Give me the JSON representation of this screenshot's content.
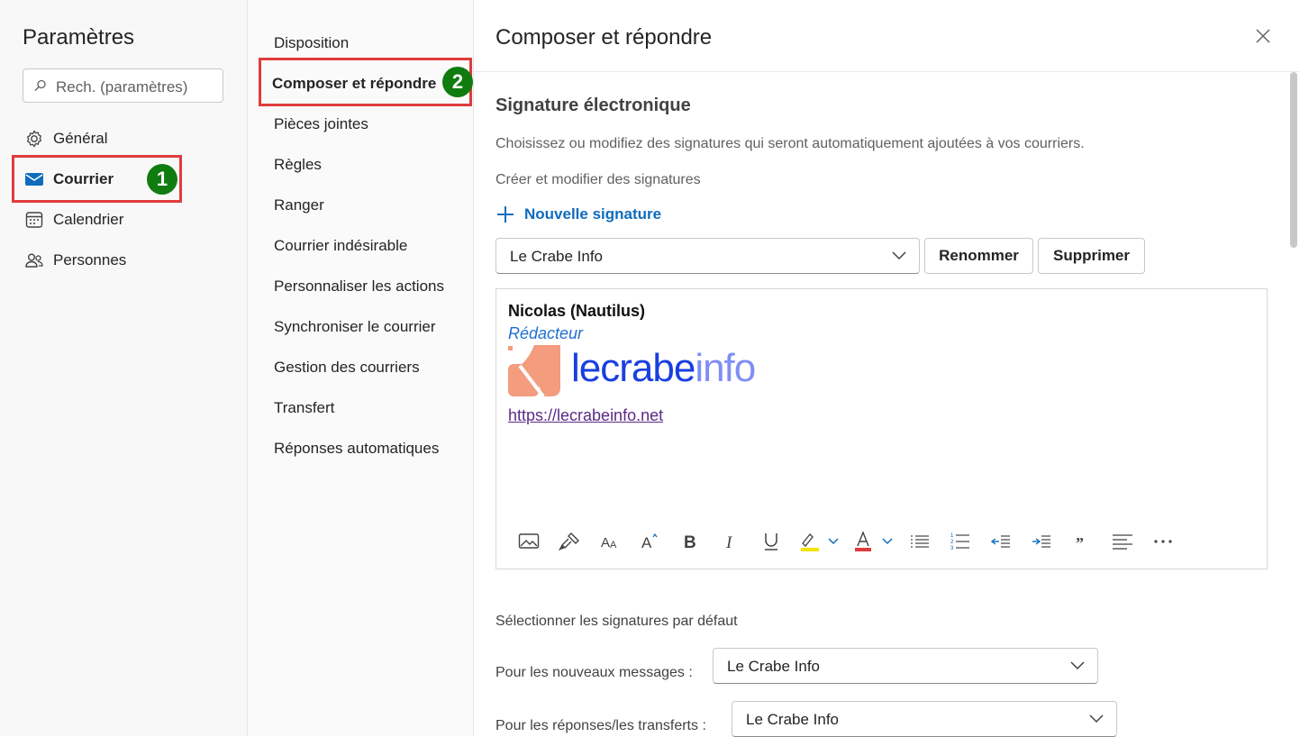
{
  "settings": {
    "title": "Paramètres",
    "search_placeholder": "Rech. (paramètres)",
    "nav": [
      {
        "label": "Général",
        "icon": "gear-icon"
      },
      {
        "label": "Courrier",
        "icon": "mail-icon",
        "active": true
      },
      {
        "label": "Calendrier",
        "icon": "calendar-icon"
      },
      {
        "label": "Personnes",
        "icon": "people-icon"
      }
    ],
    "badge1": "1",
    "badge2": "2"
  },
  "mail_sections": [
    "Disposition",
    "Composer et répondre",
    "Pièces jointes",
    "Règles",
    "Ranger",
    "Courrier indésirable",
    "Personnaliser les actions",
    "Synchroniser le courrier",
    "Gestion des courriers",
    "Transfert",
    "Réponses automatiques"
  ],
  "main": {
    "heading": "Composer et répondre",
    "section_title": "Signature électronique",
    "description": "Choisissez ou modifiez des signatures qui seront automatiquement ajoutées à vos courriers.",
    "create_label": "Créer et modifier des signatures",
    "new_signature": "Nouvelle signature",
    "selected_signature": "Le Crabe Info",
    "rename": "Renommer",
    "delete": "Supprimer",
    "signature": {
      "name": "Nicolas (Nautilus)",
      "role": "Rédacteur",
      "logo_text_a": "lecrabe",
      "logo_text_b": "info",
      "url": "https://lecrabeinfo.net"
    },
    "defaults_label": "Sélectionner les signatures par défaut",
    "new_messages_label": "Pour les nouveaux messages :",
    "new_messages_value": "Le Crabe Info",
    "replies_label": "Pour les réponses/les transferts :",
    "replies_value": "Le Crabe Info"
  },
  "colors": {
    "accent": "#0f6cbd",
    "highlight_border": "#e03c3c",
    "badge": "#107c10"
  }
}
